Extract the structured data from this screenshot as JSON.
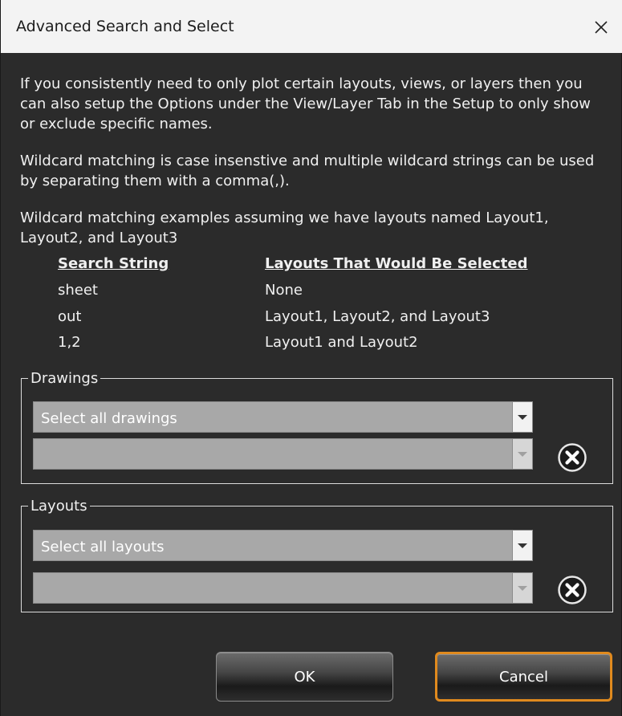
{
  "window": {
    "title": "Advanced Search and Select",
    "close_icon": "close-icon"
  },
  "info": {
    "paragraph1": "If you consistently need to only plot certain layouts, views, or layers then you can also setup the Options under the View/Layer Tab in the Setup to only show or exclude specific names.",
    "paragraph2": "Wildcard matching is case insenstive and multiple wildcard strings can be used by separating them with a comma(,).",
    "paragraph3": "Wildcard matching examples assuming we have layouts named Layout1, Layout2, and Layout3"
  },
  "examples": {
    "headers": [
      "Search String",
      "Layouts That Would Be Selected"
    ],
    "rows": [
      [
        "sheet",
        "None"
      ],
      [
        "out",
        "Layout1, Layout2, and Layout3"
      ],
      [
        "1,2",
        "Layout1 and Layout2"
      ]
    ]
  },
  "drawings": {
    "legend": "Drawings",
    "select_value": "Select all drawings",
    "search_value": ""
  },
  "layouts": {
    "legend": "Layouts",
    "select_value": "Select all layouts",
    "search_value": ""
  },
  "buttons": {
    "ok": "OK",
    "cancel": "Cancel"
  },
  "colors": {
    "background": "#2b2b2b",
    "titlebar": "#f3f3f3",
    "focus_border": "#e08a1e",
    "combo_fill": "#a8a8a8"
  }
}
